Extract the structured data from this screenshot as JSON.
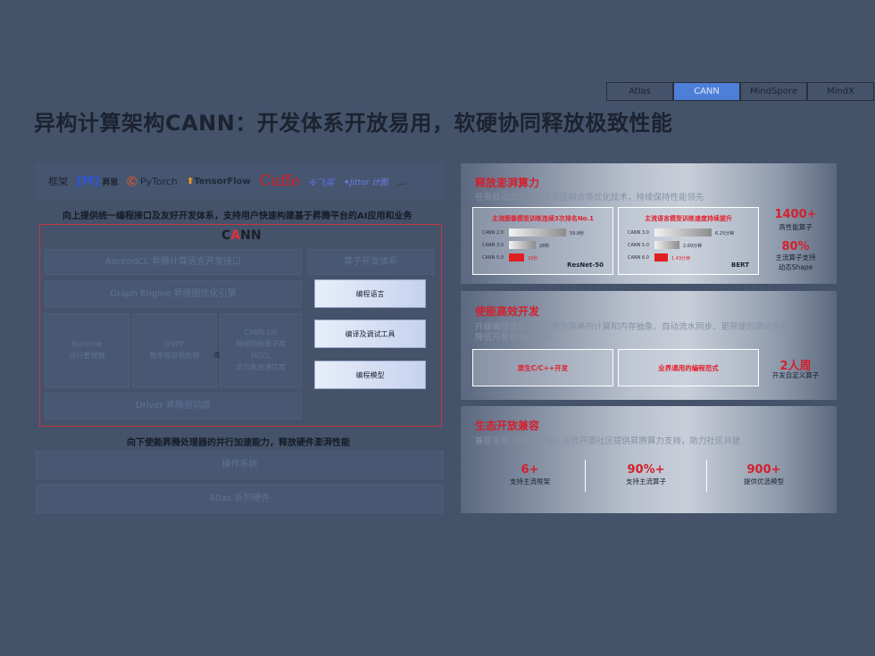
{
  "tabs": [
    "Atlas",
    "CANN",
    "MindSpore",
    "MindX"
  ],
  "title": "异构计算架构CANN：开发体系开放易用，软硬协同释放极致性能",
  "left": {
    "frameworks_label": "框架",
    "logos": {
      "mindspore": "[M]",
      "mindspore_cn": "昇思",
      "pytorch": "PyTorch",
      "tensorflow": "TensorFlow",
      "caffe": "Caffe",
      "paddle": "飞桨",
      "jittor": "Jittor 计图",
      "more": "..."
    },
    "top_caption": "向上提供统一编程接口及友好开发体系，支持用户快速构建基于昇腾平台的AI应用和业务",
    "cann_logo_a": "C",
    "cann_logo_red": "A",
    "cann_logo_b": "NN",
    "ascendcl": "AscendCL 昇腾计算语言开发接口",
    "operator_dev": "算子开发体系",
    "graph_engine": "Graph Engine 昇腾图优化引擎",
    "runtime_line1": "Runtime",
    "runtime_line2": "运行管理器",
    "dvpp_line1": "DVPP",
    "dvpp_line2": "数字视觉预处理",
    "cannlib_line1": "CANN Lib",
    "cannlib_line2": "神经网络算子库",
    "hccl_line1": "HCCL",
    "hccl_line2": "华为集合通信库",
    "small_mark": "图",
    "btn_lang": "编程语言",
    "btn_tools": "编译及调试工具",
    "btn_model": "编程模型",
    "driver": "Driver 昇腾驱动层",
    "bottom_caption": "向下使能昇腾处理器的并行加速能力，释放硬件澎湃性能",
    "os": "操作系统",
    "atlas_hw": "Atlas 系列硬件"
  },
  "right": {
    "s1": {
      "head": "释放澎湃算力",
      "sub": "任务自动流水、算子深度融合等优化技术，持续保持性能领先",
      "card1": {
        "title": "主流图像模型训练连续3次排名No.1",
        "rows": [
          {
            "label": "CANN 2.0",
            "value": "59.8秒",
            "frac": 1.0,
            "red": false
          },
          {
            "label": "CANN 3.0",
            "value": "28秒",
            "frac": 0.47,
            "red": false
          },
          {
            "label": "CANN 5.0",
            "value": "16秒",
            "frac": 0.27,
            "red": true
          }
        ],
        "model": "ResNet-50"
      },
      "card2": {
        "title": "主流语言模型训练速度持续提升",
        "rows": [
          {
            "label": "CANN 3.0",
            "value": "6.25分钟",
            "frac": 1.0,
            "red": false
          },
          {
            "label": "CANN 5.0",
            "value": "2.69分钟",
            "frac": 0.43,
            "red": false
          },
          {
            "label": "CANN 6.0",
            "value": "1.43分钟",
            "frac": 0.23,
            "red": true
          }
        ],
        "model": "BERT"
      },
      "stat1_big": "1400+",
      "stat1_small": "高性能算子",
      "stat2_big": "80%",
      "stat2_small1": "主流算子支持",
      "stat2_small2": "动态Shape"
    },
    "s2": {
      "head": "使能高效开发",
      "sub1": "升级编程语言，提供更为简单的计算和内存抽象、自动流水同步、更简便的调试手段，",
      "sub2": "降低开发者编码成本",
      "box1": "原生C/C++开发",
      "box2": "业界通用的编程范式",
      "stat_big": "2人周",
      "stat_small": "开发自定义算子"
    },
    "s3": {
      "head": "生态开放兼容",
      "sub": "兼容主流 AI框架，接入主流开源社区提供昇腾算力支持，助力社区共建",
      "stats": [
        {
          "big": "6+",
          "small": "支持主流框架"
        },
        {
          "big": "90%+",
          "small": "支持主流算子"
        },
        {
          "big": "900+",
          "small": "提供优选模型"
        }
      ]
    }
  },
  "colors": {
    "accent_red": "#d4202d",
    "tab_active": "#4d7fd9",
    "background": "#44536a"
  }
}
